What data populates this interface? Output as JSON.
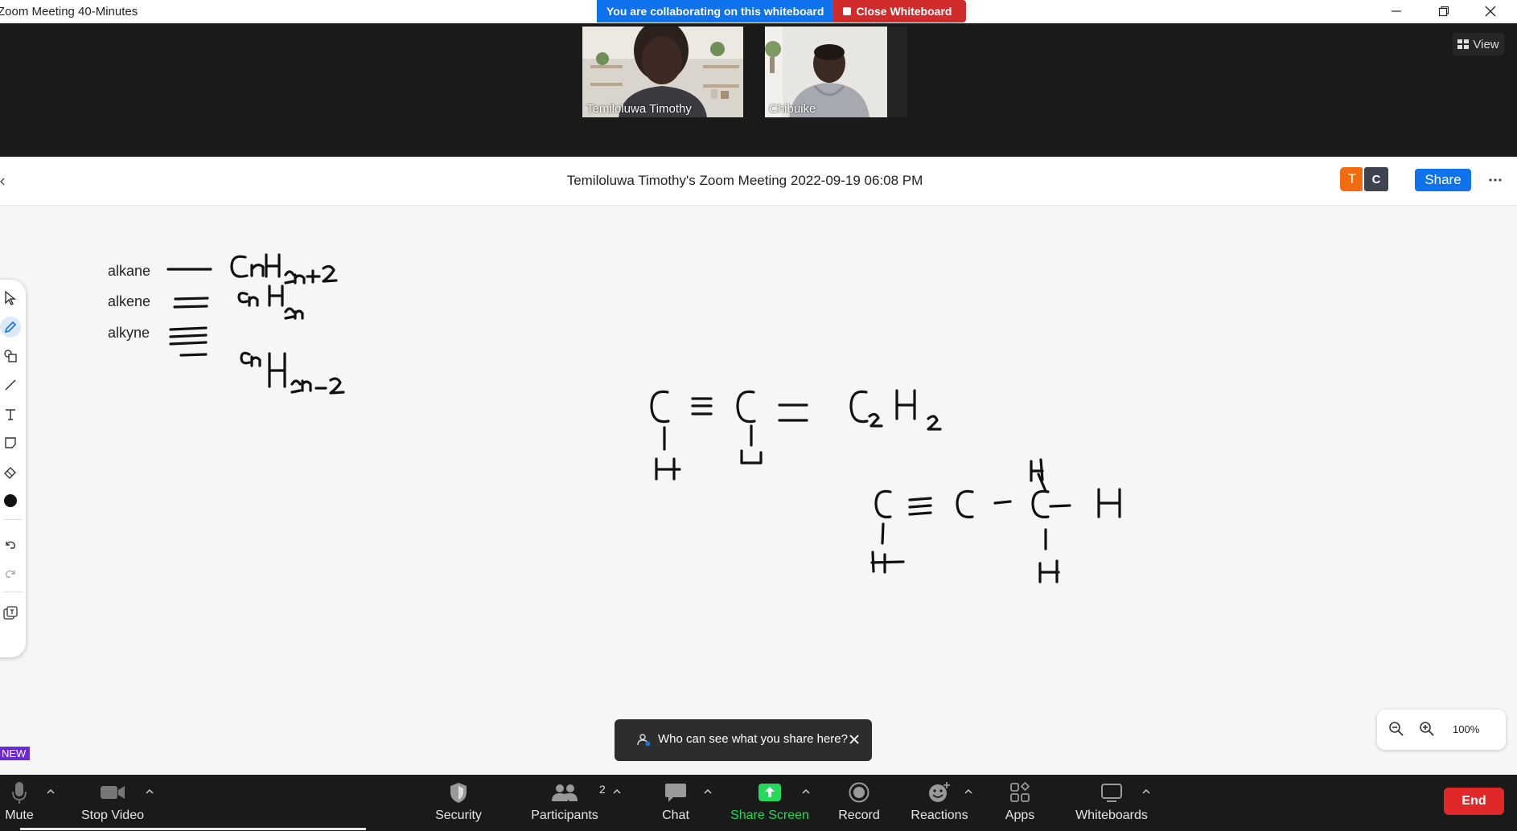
{
  "window": {
    "title": "Zoom Meeting 40-Minutes",
    "collab_message": "You are collaborating on this whiteboard",
    "close_whiteboard_label": "Close Whiteboard"
  },
  "video": {
    "participants": [
      {
        "name": "Temiloluwa Timothy"
      },
      {
        "name": "Chibuike"
      }
    ],
    "view_label": "View"
  },
  "whiteboard": {
    "meeting_title": "Temiloluwa Timothy's Zoom Meeting 2022-09-19 06:08 PM",
    "collaborators": [
      {
        "initial": "T",
        "color": "#f26b0f"
      },
      {
        "initial": "C",
        "color": "#3d4350"
      }
    ],
    "share_label": "Share",
    "labels": [
      "alkane",
      "alkene",
      "alkyne"
    ],
    "zoom_level": "100%"
  },
  "toast": {
    "text": "Who can see what you share here?"
  },
  "new_badge": "NEW",
  "bottombar": {
    "mute": "Mute",
    "stop_video": "Stop Video",
    "security": "Security",
    "participants": "Participants",
    "participants_count": "2",
    "chat": "Chat",
    "share_screen": "Share Screen",
    "record": "Record",
    "reactions": "Reactions",
    "apps": "Apps",
    "whiteboards": "Whiteboards",
    "end": "End"
  },
  "colors": {
    "accent_blue": "#0e72ed",
    "danger_red": "#e02828",
    "share_green": "#23d959"
  }
}
